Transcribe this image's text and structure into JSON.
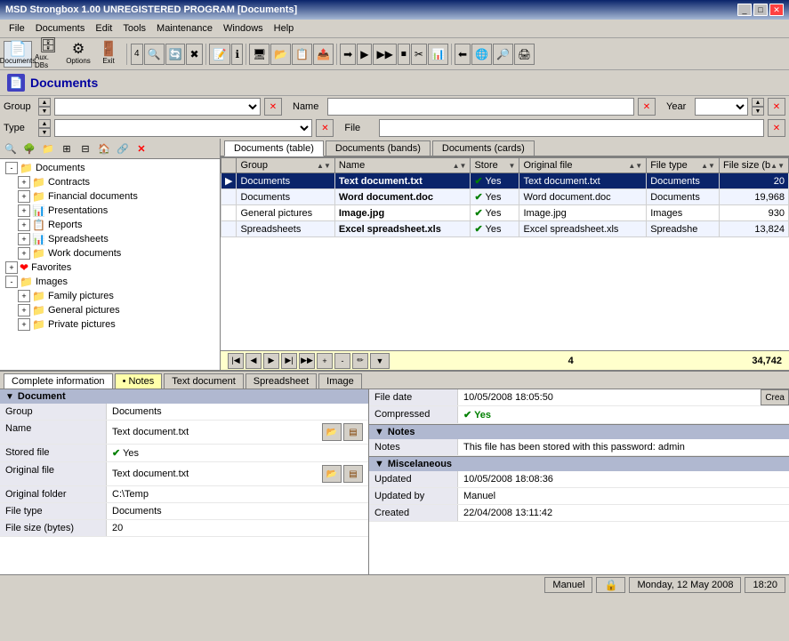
{
  "titleBar": {
    "title": "MSD Strongbox 1.00 UNREGISTERED PROGRAM [Documents]",
    "buttons": [
      "_",
      "□",
      "✕"
    ]
  },
  "menuBar": {
    "items": [
      "File",
      "Documents",
      "Edit",
      "Tools",
      "Maintenance",
      "Windows",
      "Help"
    ]
  },
  "toolbar": {
    "buttons": [
      {
        "name": "documents-btn",
        "icon": "📄",
        "label": "Documents"
      },
      {
        "name": "auxdbs-btn",
        "icon": "🗄",
        "label": "Aux. DBs"
      },
      {
        "name": "options-btn",
        "icon": "⚙",
        "label": "Options"
      },
      {
        "name": "exit-btn",
        "icon": "🚪",
        "label": "Exit"
      }
    ]
  },
  "pageHeader": {
    "title": "Documents",
    "icon": "📄"
  },
  "filters": {
    "groupLabel": "Group",
    "nameLabel": "Name",
    "yearLabel": "Year",
    "typeLabel": "Type",
    "fileLabel": "File"
  },
  "tree": {
    "items": [
      {
        "id": "documents-root",
        "label": "Documents",
        "icon": "📁",
        "level": 0,
        "expanded": true,
        "selected": false
      },
      {
        "id": "contracts",
        "label": "Contracts",
        "icon": "📁",
        "level": 1,
        "expanded": false,
        "selected": false
      },
      {
        "id": "financial",
        "label": "Financial documents",
        "icon": "📁",
        "level": 1,
        "expanded": false,
        "selected": false
      },
      {
        "id": "presentations",
        "label": "Presentations",
        "icon": "📁",
        "level": 1,
        "expanded": false,
        "selected": false
      },
      {
        "id": "reports",
        "label": "Reports",
        "icon": "📁",
        "level": 1,
        "expanded": false,
        "selected": false
      },
      {
        "id": "spreadsheets",
        "label": "Spreadsheets",
        "icon": "📁",
        "level": 1,
        "expanded": false,
        "selected": false
      },
      {
        "id": "work-docs",
        "label": "Work documents",
        "icon": "📁",
        "level": 1,
        "expanded": false,
        "selected": false
      },
      {
        "id": "favorites",
        "label": "Favorites",
        "icon": "❤",
        "level": 0,
        "expanded": false,
        "selected": false
      },
      {
        "id": "images-root",
        "label": "Images",
        "icon": "📁",
        "level": 0,
        "expanded": true,
        "selected": false
      },
      {
        "id": "family-pictures",
        "label": "Family pictures",
        "icon": "📁",
        "level": 1,
        "expanded": false,
        "selected": false
      },
      {
        "id": "general-pictures",
        "label": "General pictures",
        "icon": "📁",
        "level": 1,
        "expanded": false,
        "selected": false
      },
      {
        "id": "private-pictures",
        "label": "Private pictures",
        "icon": "📁",
        "level": 1,
        "expanded": false,
        "selected": false
      }
    ]
  },
  "mainTabs": [
    {
      "id": "table-tab",
      "label": "Documents (table)",
      "active": true
    },
    {
      "id": "bands-tab",
      "label": "Documents (bands)",
      "active": false
    },
    {
      "id": "cards-tab",
      "label": "Documents (cards)",
      "active": false
    }
  ],
  "tableColumns": [
    {
      "id": "group",
      "label": "Group"
    },
    {
      "id": "name",
      "label": "Name"
    },
    {
      "id": "stored",
      "label": "Store"
    },
    {
      "id": "original",
      "label": "Original file"
    },
    {
      "id": "filetype",
      "label": "File type"
    },
    {
      "id": "filesize",
      "label": "File size (b"
    }
  ],
  "tableRows": [
    {
      "group": "Documents",
      "name": "Text document.txt",
      "stored": "Yes",
      "original": "Text document.txt",
      "filetype": "Documents",
      "filesize": "20",
      "selected": true,
      "bold": true
    },
    {
      "group": "Documents",
      "name": "Word document.doc",
      "stored": "Yes",
      "original": "Word document.doc",
      "filetype": "Documents",
      "filesize": "19,968",
      "selected": false,
      "bold": true
    },
    {
      "group": "General pictures",
      "name": "Image.jpg",
      "stored": "Yes",
      "original": "Image.jpg",
      "filetype": "Images",
      "filesize": "930",
      "selected": false,
      "bold": true
    },
    {
      "group": "Spreadsheets",
      "name": "Excel spreadsheet.xls",
      "stored": "Yes",
      "original": "Excel spreadsheet.xls",
      "filetype": "Spreadshe",
      "filesize": "13,824",
      "selected": false,
      "bold": true
    }
  ],
  "tableFooter": {
    "count": "4",
    "total": "34,742"
  },
  "bottomTabs": [
    {
      "id": "complete-tab",
      "label": "Complete information",
      "active": true
    },
    {
      "id": "notes-tab",
      "label": "• Notes",
      "active": false
    },
    {
      "id": "textdoc-tab",
      "label": "Text document",
      "active": false
    },
    {
      "id": "spreadsheet-tab",
      "label": "Spreadsheet",
      "active": false
    },
    {
      "id": "image-tab",
      "label": "Image",
      "active": false
    }
  ],
  "infoLeft": {
    "sectionTitle": "Document",
    "fields": [
      {
        "label": "Group",
        "value": "Documents",
        "hasBtn": false
      },
      {
        "label": "Name",
        "value": "Text document.txt",
        "hasBtn": true
      },
      {
        "label": "Stored file",
        "value": "✔ Yes",
        "hasBtn": false
      },
      {
        "label": "Original file",
        "value": "Text document.txt",
        "hasBtn": true
      },
      {
        "label": "Original folder",
        "value": "C:\\Temp",
        "hasBtn": false
      },
      {
        "label": "File type",
        "value": "Documents",
        "hasBtn": false
      },
      {
        "label": "File size (bytes)",
        "value": "20",
        "hasBtn": false
      }
    ]
  },
  "infoRight": {
    "sections": [
      {
        "title": "",
        "fields": [
          {
            "label": "File date",
            "value": "10/05/2008 18:05:50"
          },
          {
            "label": "Compressed",
            "value": "✔ Yes"
          }
        ]
      },
      {
        "title": "Notes",
        "fields": [
          {
            "label": "Notes",
            "value": "This file has been stored with this password: admin"
          }
        ]
      },
      {
        "title": "Miscelaneous",
        "fields": [
          {
            "label": "Updated",
            "value": "10/05/2008 18:08:36"
          },
          {
            "label": "Updated by",
            "value": "Manuel"
          },
          {
            "label": "Created",
            "value": "22/04/2008 13:11:42"
          }
        ]
      }
    ],
    "createLabel": "Crea"
  },
  "statusBar": {
    "user": "Manuel",
    "lockIcon": "🔒",
    "date": "Monday, 12 May 2008",
    "time": "18:20"
  }
}
